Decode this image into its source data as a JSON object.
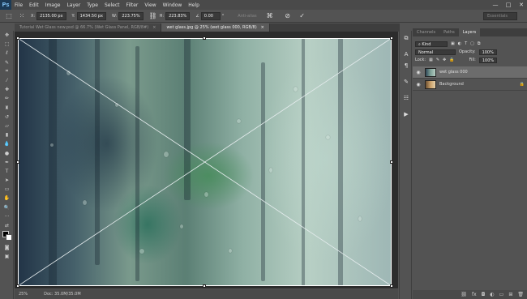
{
  "app": {
    "logo": "Ps"
  },
  "menu": [
    "File",
    "Edit",
    "Image",
    "Layer",
    "Type",
    "Select",
    "Filter",
    "View",
    "Window",
    "Help"
  ],
  "window_controls": [
    "—",
    "□",
    "✕"
  ],
  "options_bar": {
    "x_label": "X:",
    "x_value": "2135.00 px",
    "y_label": "Y:",
    "y_value": "1434.50 px",
    "w_label": "W:",
    "w_value": "223.75%",
    "h_label": "H:",
    "h_value": "223.83%",
    "angle_value": "0.00",
    "angle_unit": "°",
    "interp_label": "Anti-alias",
    "workspace": "Essentials"
  },
  "tabs": [
    {
      "label": "Tutorial Wet Glass new.psd @ 66.7% (Wet Glass Panel, RGB/8#)",
      "close": "×"
    },
    {
      "label": "wet glass.jpg @ 25% (wet glass 000, RGB/8)",
      "close": "×"
    }
  ],
  "status": {
    "zoom": "25%",
    "doc": "Doc: 35.0M/35.0M"
  },
  "panel": {
    "tabs": [
      "Channels",
      "Paths",
      "Layers"
    ],
    "kind_label": "Kind",
    "blend_mode": "Normal",
    "opacity_label": "Opacity:",
    "opacity_value": "100%",
    "lock_label": "Lock:",
    "fill_label": "Fill:",
    "fill_value": "100%",
    "layers": [
      {
        "name": "wet glass 000",
        "selected": true
      },
      {
        "name": "Background",
        "selected": false
      }
    ]
  }
}
